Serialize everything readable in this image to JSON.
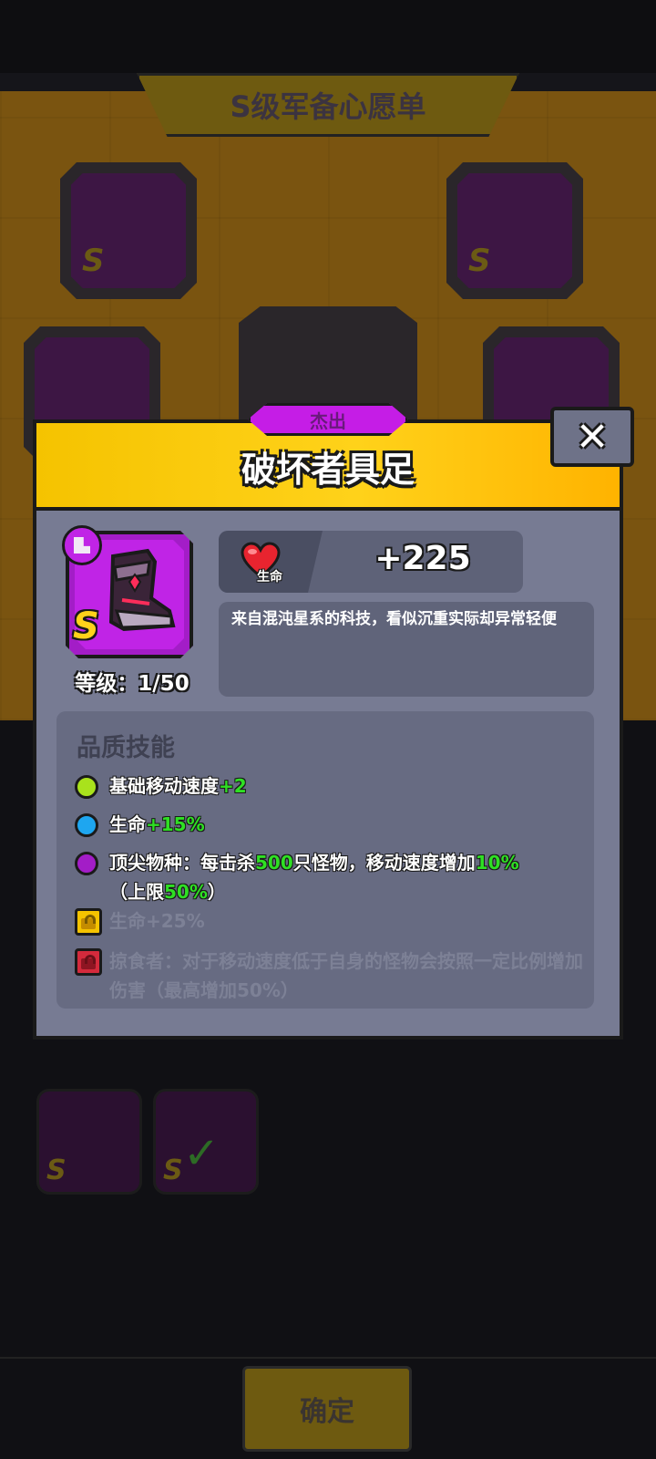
{
  "background": {
    "screen_title": "S级军备心愿单",
    "confirm_label": "确定"
  },
  "modal": {
    "rarity": "杰出",
    "title": "破坏者具足",
    "close_glyph": "✕",
    "item": {
      "grade": "S",
      "level": "等级：1/50"
    },
    "stat": {
      "name": "生命",
      "value": "+225"
    },
    "description": "来自混沌星系的科技，看似沉重实际却异常轻便",
    "skills": {
      "title": "品质技能",
      "items": [
        {
          "color": "#a9e21c",
          "text": "基础移动速度",
          "bonus": "+2"
        },
        {
          "color": "#1ea6f0",
          "text": "生命",
          "bonus": "+15%"
        },
        {
          "color": "#a31dc7",
          "p1": "顶尖物种：每击杀",
          "v1": "500",
          "p2": "只怪物，移动速度增加",
          "v2": "10%",
          "p3": "（上限",
          "v3": "50%",
          "p4": "）"
        }
      ],
      "locked": [
        {
          "lock_color": "#f5c300",
          "text": "生命+25%"
        },
        {
          "lock_color": "#d42a3c",
          "text": "掠食者：对于移动速度低于自身的怪物会按照一定比例增加伤害（最高增加50%）"
        }
      ]
    }
  },
  "colors": {
    "header_yellow": "#ffd21a",
    "rarity_purple": "#c51de6",
    "highlight_green": "#2fe024"
  }
}
